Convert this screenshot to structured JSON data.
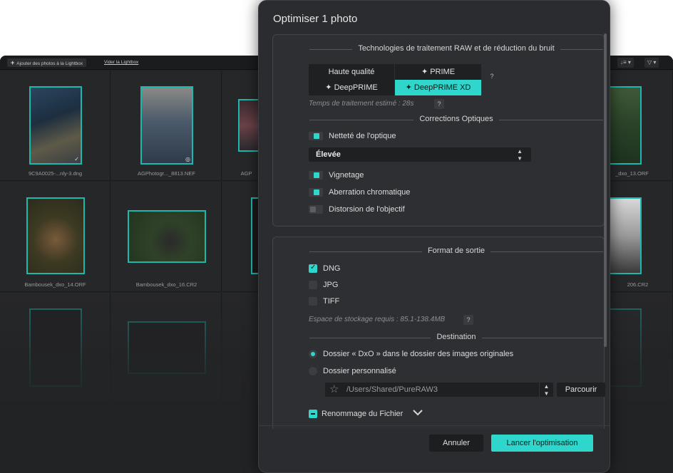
{
  "app": {
    "toolbar": {
      "add_label": "Ajouter des photos à la Lightbox",
      "clear_label": "Vider la Lightbox",
      "sort_label": "↓≡ ▾",
      "filter_label": "▽ ▾"
    },
    "grid": {
      "captions": [
        "9C9A0025-...nly-3.dng",
        "AGPhotogr..._8813.NEF",
        "AGP",
        "_dxo_13.ORF",
        "Bambousek_dxo_14.ORF",
        "Bambousek_dxo_16.CR2",
        "",
        "206.CR2"
      ]
    }
  },
  "dialog": {
    "title": "Optimiser 1 photo",
    "raw_section": {
      "heading": "Technologies de traitement RAW et de réduction du bruit",
      "options": [
        {
          "label": "Haute qualité",
          "icon": "",
          "active": false
        },
        {
          "label": "PRIME",
          "icon": "✦",
          "active": false
        },
        {
          "label": "DeepPRIME",
          "icon": "✦",
          "active": false
        },
        {
          "label": "DeepPRIME XD",
          "icon": "✦",
          "active": true
        }
      ],
      "help": "?",
      "time_label": "Temps de traitement estimé :",
      "time_value": "28s"
    },
    "optics_section": {
      "heading": "Corrections Optiques",
      "sharpness_label": "Netteté de l'optique",
      "sharpness_on": true,
      "sharpness_level": "Élevée",
      "vignetting_label": "Vignetage",
      "vignetting_on": true,
      "chromatic_label": "Aberration chromatique",
      "chromatic_on": true,
      "distortion_label": "Distorsion de l'objectif",
      "distortion_on": false
    },
    "output_section": {
      "heading": "Format de sortie",
      "formats": [
        {
          "label": "DNG",
          "checked": true
        },
        {
          "label": "JPG",
          "checked": false
        },
        {
          "label": "TIFF",
          "checked": false
        }
      ],
      "storage_label": "Espace de stockage requis : 85.1-138.4MB"
    },
    "destination_section": {
      "heading": "Destination",
      "option_original": "Dossier « DxO » dans le dossier des images originales",
      "option_custom": "Dossier personnalisé",
      "selected": "original",
      "path": "/Users/Shared/PureRAW3",
      "browse_label": "Parcourir"
    },
    "rename": {
      "label": "Renommage du Fichier"
    },
    "buttons": {
      "cancel": "Annuler",
      "run": "Lancer l'optimisation"
    },
    "colors": {
      "accent": "#2fd6cb",
      "panel": "#2e2f32",
      "background": "#2b2c2f"
    }
  }
}
